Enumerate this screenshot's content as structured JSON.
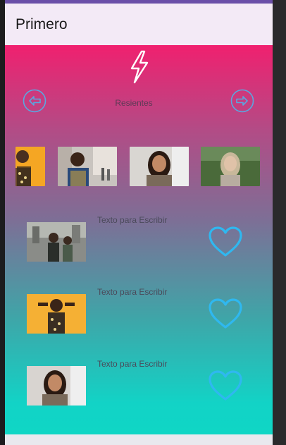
{
  "appbar": {
    "title": "Primero"
  },
  "recent": {
    "label": "Resientes"
  },
  "icons": {
    "top": "lightning-bolt-icon",
    "prev": "arrow-left-circle-icon",
    "next": "arrow-right-circle-icon",
    "favorite": "heart-outline-icon"
  },
  "colors": {
    "gradient_top": "#f0206f",
    "gradient_bottom": "#0fd6c5",
    "heart_stroke": "#2fb8f0",
    "nav_stroke": "#5aa7e0",
    "appbar_bg": "#f3eaf6"
  },
  "list": {
    "items": [
      {
        "text": "Texto para Escribir"
      },
      {
        "text": "Texto para Escribir"
      },
      {
        "text": "Texto para Escribir"
      }
    ]
  }
}
